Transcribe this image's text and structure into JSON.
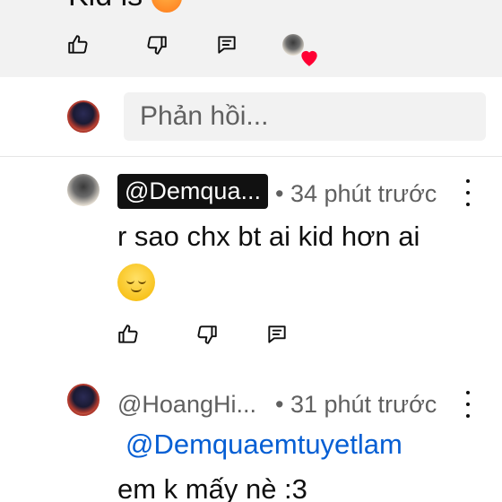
{
  "top_comment": {
    "text_fragment": "Kid is",
    "actions": {
      "like_icon": "thumbs-up-icon",
      "dislike_icon": "thumbs-down-icon",
      "reply_icon": "comment-reply-icon",
      "creator_heart_icon": "creator-heart-icon"
    }
  },
  "reply_box": {
    "placeholder": "Phản hồi..."
  },
  "replies": [
    {
      "author": "@Demqua...",
      "highlighted_author": true,
      "time": "• 34 phút trước",
      "text": "r sao chx bt ai kid hơn ai",
      "emoji": "relieved-face-emoji"
    },
    {
      "author": "@HoangHi...",
      "highlighted_author": false,
      "time": "• 31 phút trước",
      "mention": "@Demquaemtuyetlam",
      "text": "em k mấy nè :3"
    }
  ],
  "colors": {
    "link": "#065fd4",
    "secondary_text": "#606060",
    "heart": "#ff0033"
  }
}
